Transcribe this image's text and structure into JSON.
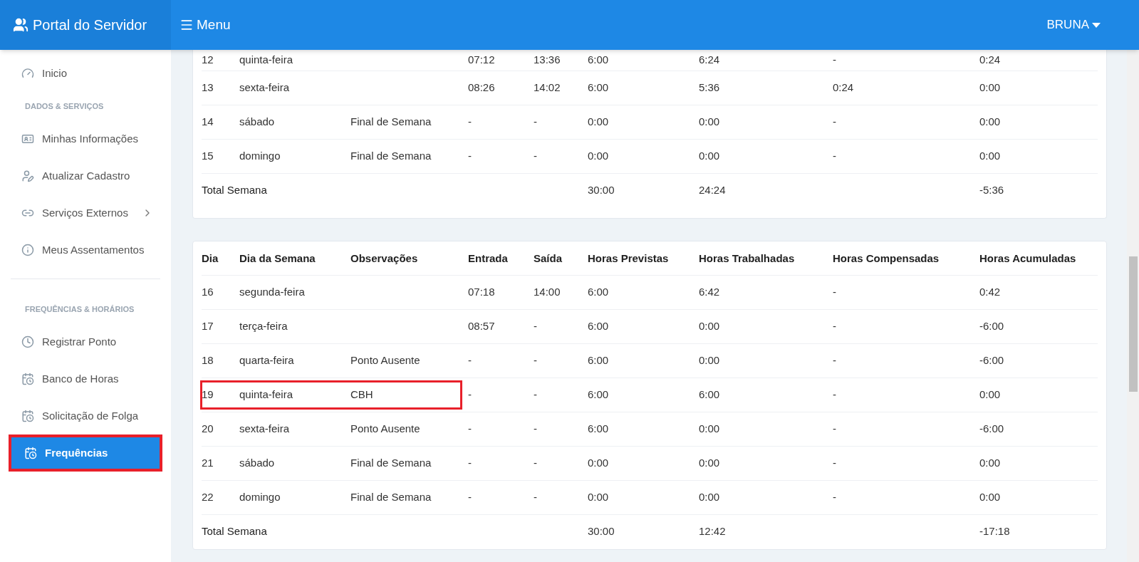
{
  "header": {
    "brand": "Portal do Servidor",
    "menu_label": "Menu",
    "user": "BRUNA"
  },
  "sidebar": {
    "items": [
      {
        "kind": "item",
        "label": "Inicio",
        "selected": false,
        "annotated": false
      },
      {
        "kind": "section",
        "label": "DADOS & SERVIÇOS"
      },
      {
        "kind": "item",
        "label": "Minhas Informações",
        "selected": false,
        "annotated": false
      },
      {
        "kind": "item",
        "label": "Atualizar Cadastro",
        "selected": false,
        "annotated": false
      },
      {
        "kind": "item",
        "label": "Serviços Externos",
        "selected": false,
        "annotated": false,
        "submenu": true
      },
      {
        "kind": "item",
        "label": "Meus Assentamentos",
        "selected": false,
        "annotated": false
      },
      {
        "kind": "divider"
      },
      {
        "kind": "section",
        "label": "FREQUÊNCIAS & HORÁRIOS"
      },
      {
        "kind": "item",
        "label": "Registrar Ponto",
        "selected": false,
        "annotated": false
      },
      {
        "kind": "item",
        "label": "Banco de Horas",
        "selected": false,
        "annotated": false
      },
      {
        "kind": "item",
        "label": "Solicitação de Folga",
        "selected": false,
        "annotated": false
      },
      {
        "kind": "item",
        "label": "Frequências",
        "selected": true,
        "annotated": true
      }
    ]
  },
  "weeks": [
    {
      "rows": [
        {
          "cells": [
            "12",
            "quinta-feira",
            "",
            "07:12",
            "13:36",
            "6:00",
            "6:24",
            "-",
            "0:24"
          ],
          "annotated": false
        },
        {
          "cells": [
            "13",
            "sexta-feira",
            "",
            "08:26",
            "14:02",
            "6:00",
            "5:36",
            "0:24",
            "0:00"
          ],
          "annotated": false
        },
        {
          "cells": [
            "14",
            "sábado",
            "Final de Semana",
            "-",
            "-",
            "0:00",
            "0:00",
            "-",
            "0:00"
          ],
          "annotated": false
        },
        {
          "cells": [
            "15",
            "domingo",
            "Final de Semana",
            "-",
            "-",
            "0:00",
            "0:00",
            "-",
            "0:00"
          ],
          "annotated": false
        }
      ],
      "total": {
        "label": "Total Semana",
        "previstas": "30:00",
        "trabalhadas": "24:24",
        "acumuladas": "-5:36"
      }
    },
    {
      "columns": [
        "Dia",
        "Dia da Semana",
        "Observações",
        "Entrada",
        "Saída",
        "Horas Previstas",
        "Horas Trabalhadas",
        "Horas Compensadas",
        "Horas Acumuladas"
      ],
      "rows": [
        {
          "cells": [
            "16",
            "segunda-feira",
            "",
            "07:18",
            "14:00",
            "6:00",
            "6:42",
            "-",
            "0:42"
          ],
          "annotated": false
        },
        {
          "cells": [
            "17",
            "terça-feira",
            "",
            "08:57",
            "-",
            "6:00",
            "0:00",
            "-",
            "-6:00"
          ],
          "annotated": false
        },
        {
          "cells": [
            "18",
            "quarta-feira",
            "Ponto Ausente",
            "-",
            "-",
            "6:00",
            "0:00",
            "-",
            "-6:00"
          ],
          "annotated": false
        },
        {
          "cells": [
            "19",
            "quinta-feira",
            "CBH",
            "-",
            "-",
            "6:00",
            "6:00",
            "-",
            "0:00"
          ],
          "annotated": true
        },
        {
          "cells": [
            "20",
            "sexta-feira",
            "Ponto Ausente",
            "-",
            "-",
            "6:00",
            "0:00",
            "-",
            "-6:00"
          ],
          "annotated": false
        },
        {
          "cells": [
            "21",
            "sábado",
            "Final de Semana",
            "-",
            "-",
            "0:00",
            "0:00",
            "-",
            "0:00"
          ],
          "annotated": false
        },
        {
          "cells": [
            "22",
            "domingo",
            "Final de Semana",
            "-",
            "-",
            "0:00",
            "0:00",
            "-",
            "0:00"
          ],
          "annotated": false
        }
      ],
      "total": {
        "label": "Total Semana",
        "previstas": "30:00",
        "trabalhadas": "12:42",
        "acumuladas": "-17:18"
      }
    }
  ]
}
